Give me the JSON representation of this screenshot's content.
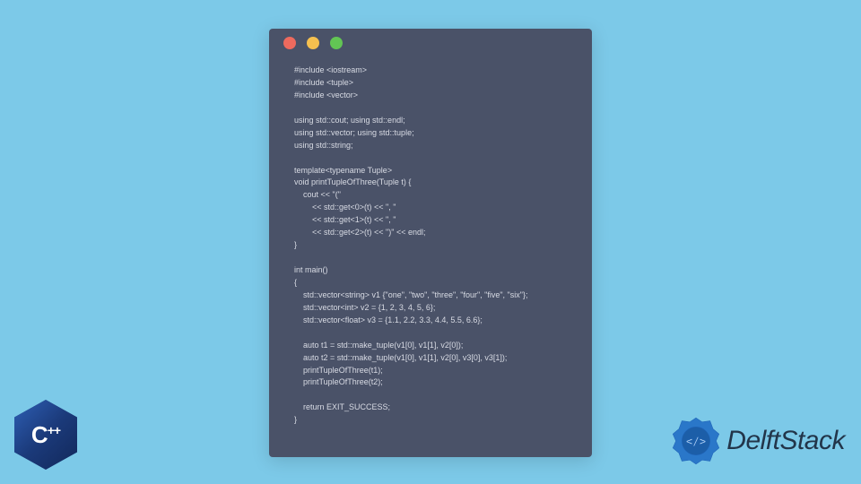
{
  "window": {
    "dots": {
      "red": "#ed6a5e",
      "yellow": "#f5c04f",
      "green": "#62c554"
    }
  },
  "code": {
    "lines": "#include <iostream>\n#include <tuple>\n#include <vector>\n\nusing std::cout; using std::endl;\nusing std::vector; using std::tuple;\nusing std::string;\n\ntemplate<typename Tuple>\nvoid printTupleOfThree(Tuple t) {\n    cout << \"(\"\n        << std::get<0>(t) << \", \"\n        << std::get<1>(t) << \", \"\n        << std::get<2>(t) << \")\" << endl;\n}\n\nint main()\n{\n    std::vector<string> v1 {\"one\", \"two\", \"three\", \"four\", \"five\", \"six\"};\n    std::vector<int> v2 = {1, 2, 3, 4, 5, 6};\n    std::vector<float> v3 = {1.1, 2.2, 3.3, 4.4, 5.5, 6.6};\n\n    auto t1 = std::make_tuple(v1[0], v1[1], v2[0]);\n    auto t2 = std::make_tuple(v1[0], v1[1], v2[0], v3[0], v3[1]);\n    printTupleOfThree(t1);\n    printTupleOfThree(t2);\n\n    return EXIT_SUCCESS;\n}"
  },
  "badges": {
    "cpp": "C++",
    "brand": "DelftStack"
  },
  "colors": {
    "background": "#7cc9e8",
    "window_bg": "#4a5268",
    "code_text": "#d8dbe4",
    "cpp_hex": "#1b3a7a",
    "brand_accent": "#1f64b8",
    "brand_text": "#22354a"
  }
}
